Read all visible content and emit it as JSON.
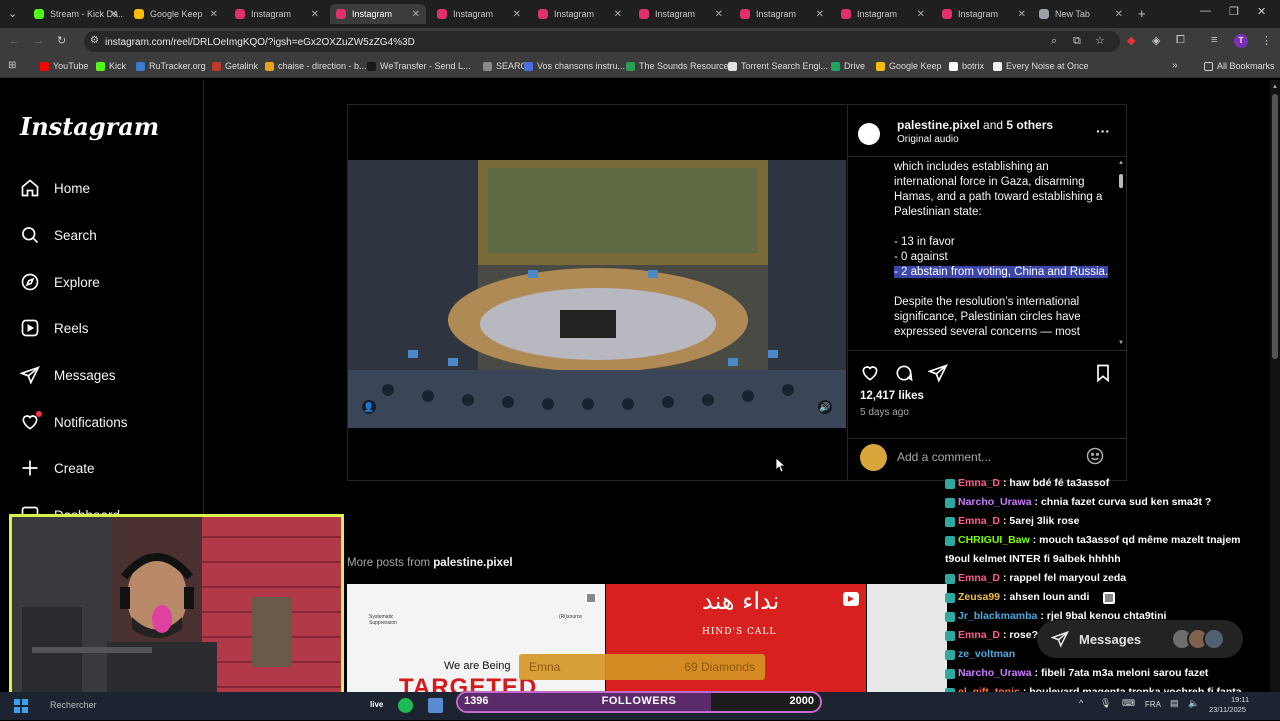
{
  "browser": {
    "tabs": [
      {
        "title": "Stream - Kick Da...",
        "color": "#53fc18",
        "active": false
      },
      {
        "title": "Google Keep",
        "color": "#fbbc04",
        "active": false
      },
      {
        "title": "Instagram",
        "color": "#e1306c",
        "active": false
      },
      {
        "title": "Instagram",
        "color": "#e1306c",
        "active": true
      },
      {
        "title": "Instagram",
        "color": "#e1306c",
        "active": false
      },
      {
        "title": "Instagram",
        "color": "#e1306c",
        "active": false
      },
      {
        "title": "Instagram",
        "color": "#e1306c",
        "active": false
      },
      {
        "title": "Instagram",
        "color": "#e1306c",
        "active": false
      },
      {
        "title": "Instagram",
        "color": "#e1306c",
        "active": false
      },
      {
        "title": "Instagram",
        "color": "#e1306c",
        "active": false
      },
      {
        "title": "New Tab",
        "color": "#9aa0a6",
        "active": false
      }
    ],
    "url": "instagram.com/reel/DRLOeImgKQO/?igsh=eGx2OXZuZW5zZG4%3D",
    "profile_initial": "T",
    "bookmarks": [
      {
        "label": "YouTube",
        "color": "#ff0000"
      },
      {
        "label": "Kick",
        "color": "#53fc18"
      },
      {
        "label": "RuTracker.org",
        "color": "#3d7bd0"
      },
      {
        "label": "Getalink",
        "color": "#c0392b"
      },
      {
        "label": "chaise - direction - b...",
        "color": "#e8a21a"
      },
      {
        "label": "WeTransfer - Send L...",
        "color": "#17181a"
      },
      {
        "label": "SEARCH",
        "color": "#8a8a8a"
      },
      {
        "label": "Vos chansons instru...",
        "color": "#4a6ee0"
      },
      {
        "label": "The Sounds Resource",
        "color": "#2a9d52"
      },
      {
        "label": "Torrent Search Engi...",
        "color": "#e0e0e0"
      },
      {
        "label": "Drive",
        "color": "#1fa463"
      },
      {
        "label": "Google Keep",
        "color": "#fbbc04"
      },
      {
        "label": "botrix",
        "color": "#ffffff"
      },
      {
        "label": "Every Noise at Once",
        "color": "#f0f0f0"
      }
    ],
    "all_bookmarks": "All Bookmarks"
  },
  "instagram": {
    "logo": "Instagram",
    "nav": [
      {
        "label": "Home",
        "icon": "home-icon"
      },
      {
        "label": "Search",
        "icon": "search-icon"
      },
      {
        "label": "Explore",
        "icon": "compass-icon"
      },
      {
        "label": "Reels",
        "icon": "reels-icon"
      },
      {
        "label": "Messages",
        "icon": "send-icon"
      },
      {
        "label": "Notifications",
        "icon": "heart-icon"
      },
      {
        "label": "Create",
        "icon": "plus-icon"
      },
      {
        "label": "Dashboard",
        "icon": "dashboard-icon"
      }
    ],
    "post": {
      "author": "palestine.pixel",
      "and_text": "and",
      "others": "5 others",
      "audio": "Original audio",
      "caption_lines": [
        "which includes establishing an",
        "international force in Gaza, disarming",
        "Hamas, and a path toward establishing a",
        "Palestinian state:",
        "",
        "- 13 in favor",
        "- 0 against"
      ],
      "caption_highlight": "- 2 abstain from voting, China and Russia.",
      "caption_after": "Despite the resolution’s international significance, Palestinian circles have expressed several concerns — most",
      "likes": "12,417 likes",
      "time_ago": "5 days ago",
      "comment_placeholder": "Add a comment..."
    },
    "more_posts_prefix": "More posts from",
    "more_posts_author": "palestine.pixel",
    "thumb1_small_left": "Systematic Suppression",
    "thumb1_small_right": "(Ri)source",
    "thumb1_text": "We are Being",
    "thumb1_big": "TARGETED",
    "thumb2_arabic": "نداء هند",
    "thumb2_text": "HIND'S CALL",
    "messages_pill": "Messages"
  },
  "chat": [
    {
      "name": "Emna_D",
      "color": "#ff5b8f",
      "msg": ": haw bdé fé ta3assof"
    },
    {
      "name": "Narcho_Urawa",
      "color": "#c77dff",
      "msg": ": chnia fazet curva sud ken sma3t ?"
    },
    {
      "name": "Emna_D",
      "color": "#ff5b8f",
      "msg": ": 5arej 3lik rose"
    },
    {
      "name": "CHRIGUI_Baw",
      "color": "#7cfc00",
      "msg": ": mouch ta3assof qd même mazelt tnajem"
    },
    {
      "name": "",
      "color": "#ffffff",
      "msg": "t9oul kelmet INTER fi 9albek hhhhh"
    },
    {
      "name": "Emna_D",
      "color": "#ff5b8f",
      "msg": ": rappel fel maryoul zeda"
    },
    {
      "name": "Zeusa99",
      "color": "#f0c040",
      "msg": ": ahsen loun andi"
    },
    {
      "name": "Jr_blackmamba",
      "color": "#4ea8de",
      "msg": ": rjel 9bal kenou chta9tini"
    },
    {
      "name": "Emna_D",
      "color": "#ff5b8f",
      "msg": ": rose?"
    },
    {
      "name": "ze_voltman",
      "color": "#4ea8de",
      "msg": ""
    },
    {
      "name": "Narcho_Urawa",
      "color": "#c77dff",
      "msg": ": fibeli 7ata m3a meloni sarou fazet"
    },
    {
      "name": "el_gift_tonic",
      "color": "#ff6b3d",
      "msg": ": boulevard magenta tronka yochreb fi fanta"
    },
    {
      "name": "Narcho_Urawa",
      "color": "#c77dff",
      "msg": ":"
    }
  ],
  "overlay": {
    "followers_label": "FOLLOWERS",
    "followers_current": "1396",
    "followers_goal": "2000",
    "followers_progress": 0.698,
    "donation_name": "Emna",
    "donation_amount": "69 Diamonds"
  },
  "taskbar": {
    "search_placeholder": "Rechercher",
    "lang": "FRA",
    "time": "19:11",
    "date": "23/11/2025"
  },
  "colors": {
    "instagram_bg": "#000000",
    "highlight": "#3b46a8",
    "webcam_border": "#d9f24a",
    "follow_border": "#c26ac9"
  }
}
